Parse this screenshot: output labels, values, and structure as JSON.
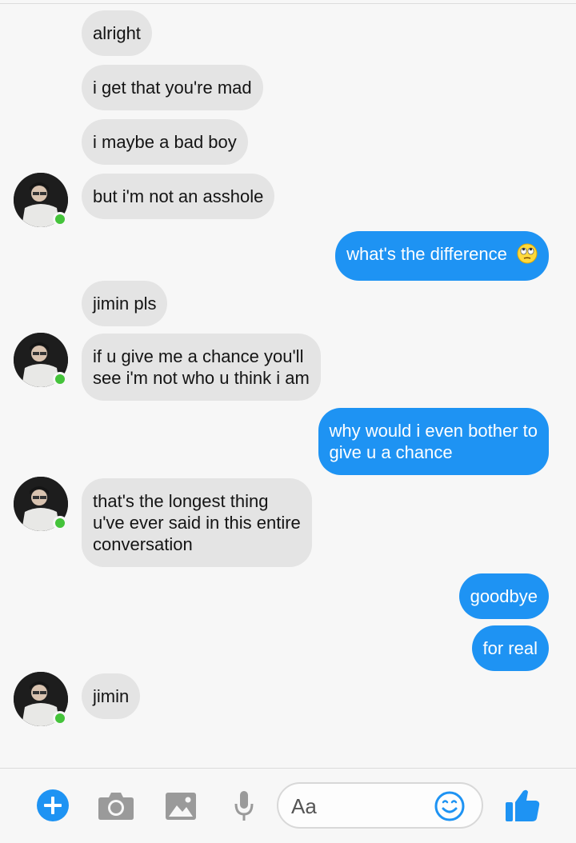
{
  "messages": [
    {
      "text": "alright",
      "from": "them"
    },
    {
      "text": "i get that you're mad",
      "from": "them"
    },
    {
      "text": "i maybe a bad boy",
      "from": "them"
    },
    {
      "text": "but i'm not an asshole",
      "from": "them"
    },
    {
      "text": "what's the difference",
      "from": "me",
      "emoji": "face-with-rolling-eyes"
    },
    {
      "text": "jimin pls",
      "from": "them"
    },
    {
      "lines": [
        "if u give me a chance you'll",
        "see i'm not who u think i am"
      ],
      "from": "them"
    },
    {
      "lines": [
        "why would i even bother to",
        "give u a chance"
      ],
      "from": "me"
    },
    {
      "lines": [
        "that's the longest thing",
        "u've ever said in this entire",
        "conversation"
      ],
      "from": "them"
    },
    {
      "text": "goodbye",
      "from": "me"
    },
    {
      "text": "for real",
      "from": "me"
    },
    {
      "text": "jimin",
      "from": "them"
    }
  ],
  "composer": {
    "placeholder": "Aa"
  },
  "toolbar": {
    "icons": [
      "plus-icon",
      "camera-icon",
      "image-icon",
      "microphone-icon",
      "emoji-icon",
      "thumbs-up-icon"
    ]
  },
  "colors": {
    "outgoing": "#1e93f3",
    "incoming": "#e4e4e4",
    "accent": "#1e93f3",
    "online": "#44c33a"
  }
}
